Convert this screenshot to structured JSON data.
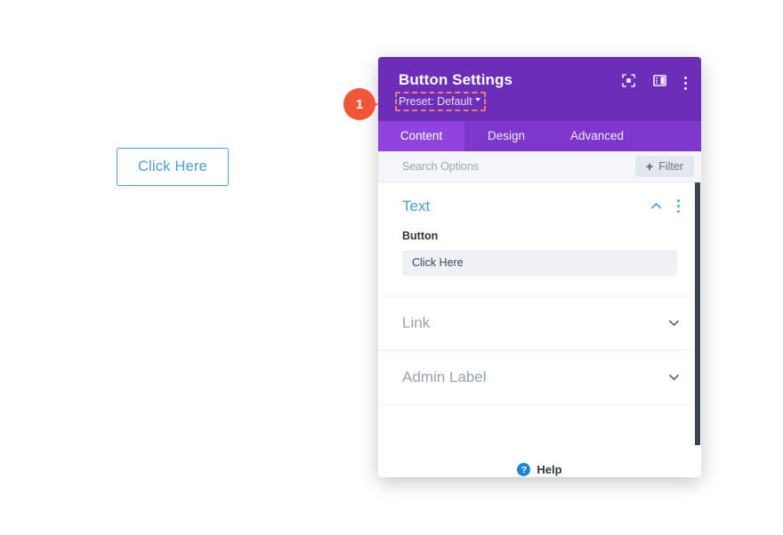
{
  "canvas": {
    "button_label": "Click Here"
  },
  "marker": {
    "number": "1"
  },
  "panel": {
    "title": "Button Settings",
    "preset_label": "Preset: Default",
    "header_icons": [
      {
        "name": "fullscreen-icon"
      },
      {
        "name": "panel-layout-icon"
      },
      {
        "name": "more-options-icon"
      }
    ],
    "tabs": [
      {
        "label": "Content",
        "active": true
      },
      {
        "label": "Design",
        "active": false
      },
      {
        "label": "Advanced",
        "active": false
      }
    ],
    "search": {
      "placeholder": "Search Options",
      "value": ""
    },
    "filter_button": {
      "label": "Filter",
      "plus": "+"
    },
    "sections": [
      {
        "title": "Text",
        "state": "expanded",
        "field_label": "Button",
        "field_value": "Click Here"
      },
      {
        "title": "Link",
        "state": "collapsed"
      },
      {
        "title": "Admin Label",
        "state": "collapsed"
      }
    ],
    "help": {
      "label": "Help",
      "icon_glyph": "?"
    },
    "footer": {
      "close_label": "✖",
      "undo_label": "↺",
      "redo_label": "↻",
      "save_label": "✔"
    }
  },
  "colors": {
    "header_purple": "#6C2EB9",
    "tab_bar_purple": "#7e37cc",
    "tab_active_purple": "#8f45dd",
    "accent_blue": "#4a9fd8",
    "marker_orange": "#ef5737",
    "preset_outline": "#f0846a",
    "close_red": "#ec5a52",
    "undo_purple": "#7b36d4",
    "redo_blue": "#2387cf",
    "save_green": "#2bbf9a"
  }
}
